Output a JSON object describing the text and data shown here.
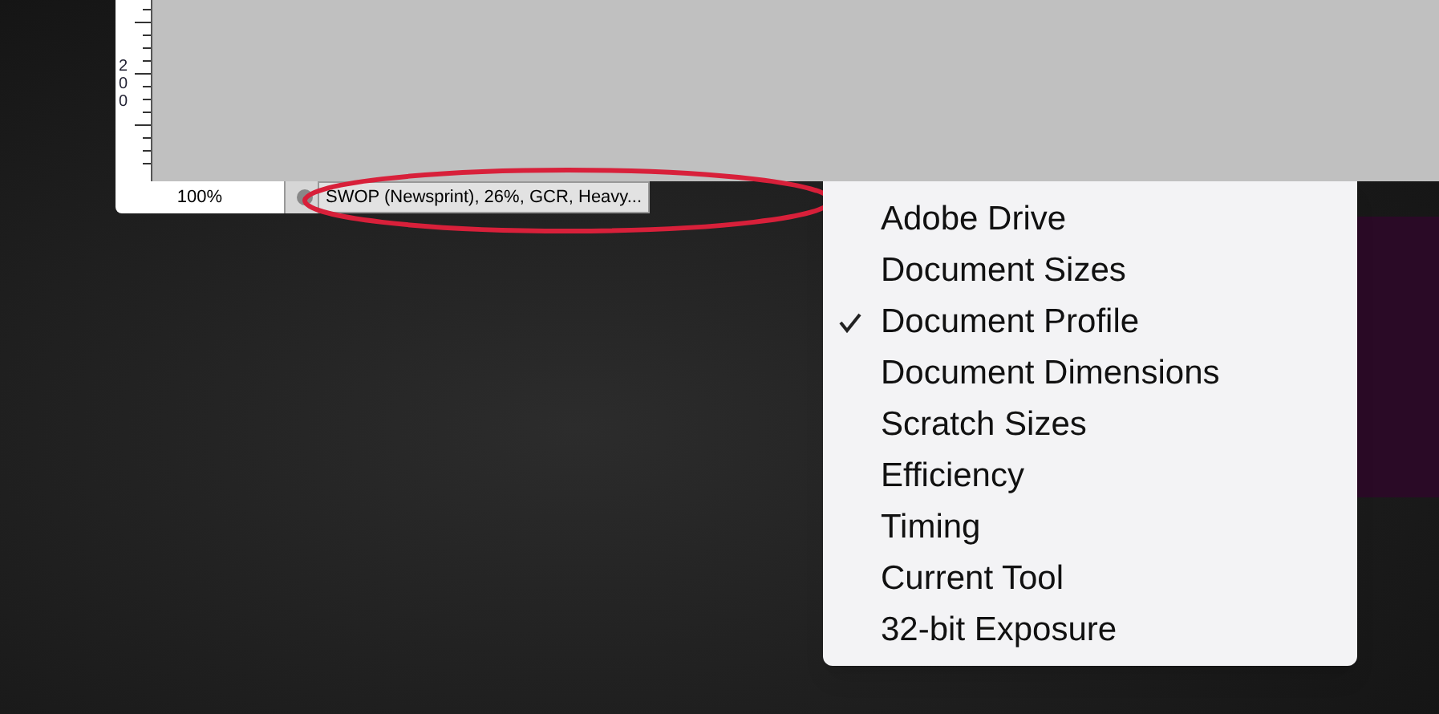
{
  "ruler": {
    "label": "200"
  },
  "status_bar": {
    "zoom": "100%",
    "info": "SWOP (Newsprint), 26%, GCR, Heavy..."
  },
  "menu": {
    "items": [
      {
        "label": "Adobe Drive",
        "checked": false
      },
      {
        "label": "Document Sizes",
        "checked": false
      },
      {
        "label": "Document Profile",
        "checked": true
      },
      {
        "label": "Document Dimensions",
        "checked": false
      },
      {
        "label": "Scratch Sizes",
        "checked": false
      },
      {
        "label": "Efficiency",
        "checked": false
      },
      {
        "label": "Timing",
        "checked": false
      },
      {
        "label": "Current Tool",
        "checked": false
      },
      {
        "label": "32-bit Exposure",
        "checked": false
      }
    ]
  }
}
